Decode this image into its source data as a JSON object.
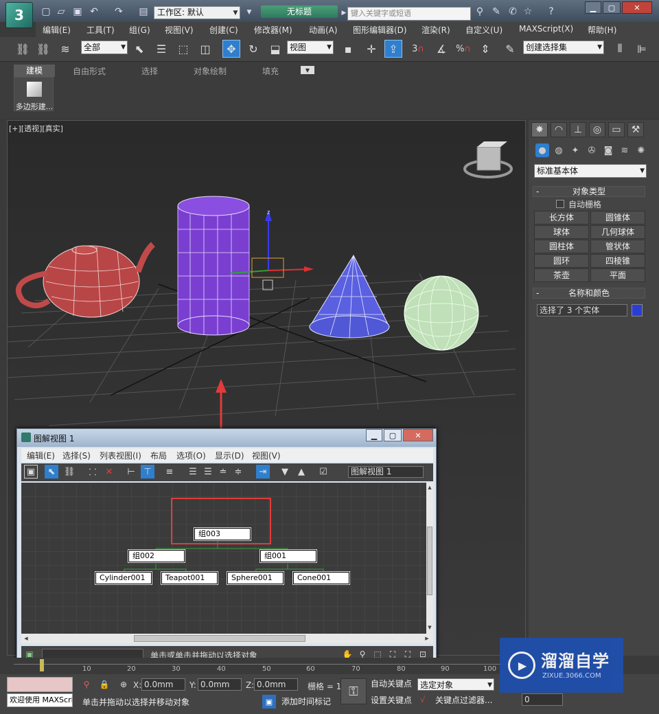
{
  "titlebar": {
    "workspace": "工作区: 默认",
    "doc_title": "无标题",
    "search_placeholder": "键入关键字或短语",
    "help_icon": "?"
  },
  "menubar": [
    "编辑(E)",
    "工具(T)",
    "组(G)",
    "视图(V)",
    "创建(C)",
    "修改器(M)",
    "动画(A)",
    "图形编辑器(D)",
    "渲染(R)",
    "自定义(U)",
    "MAXScript(X)",
    "帮助(H)"
  ],
  "maintoolbar": {
    "selection_filter": "全部",
    "coord_system": "视图",
    "snap_3": "3",
    "snap_angle": "",
    "snap_percent": "%",
    "named_selection": "创建选择集"
  },
  "ribbon": {
    "tabs": [
      "建模",
      "自由形式",
      "选择",
      "对象绘制",
      "填充"
    ],
    "poly_button": "多边形建..."
  },
  "viewport": {
    "label": "[+][透视][真实]"
  },
  "command_panel": {
    "category": "标准基本体",
    "object_type_title": "对象类型",
    "autogrid": "自动栅格",
    "objects": [
      "长方体",
      "圆锥体",
      "球体",
      "几何球体",
      "圆柱体",
      "管状体",
      "圆环",
      "四棱锥",
      "茶壶",
      "平面"
    ],
    "name_color_title": "名称和颜色",
    "name_value": "选择了 3 个实体",
    "swatch_color": "#2a3ed6"
  },
  "schematic": {
    "title": "图解视图 1",
    "menu": [
      "编辑(E)",
      "选择(S)",
      "列表视图(I)",
      "布局",
      "选项(O)",
      "显示(D)",
      "视图(V)"
    ],
    "view_name": "图解视图 1",
    "status_text": "单击或单击并拖动以选择对象",
    "nodes": {
      "group003": "组003",
      "group002": "组002",
      "group001": "组001",
      "cylinder": "Cylinder001",
      "teapot": "Teapot001",
      "sphere": "Sphere001",
      "cone": "Cone001"
    }
  },
  "timeline": {
    "ticks": [
      "10",
      "20",
      "30",
      "40",
      "50",
      "60",
      "70",
      "80",
      "90",
      "100"
    ]
  },
  "statusbar": {
    "welcome": "欢迎使用 MAXScri",
    "prompt": "单击并拖动以选择并移动对象",
    "x_label": "X:",
    "x_value": "0.0mm",
    "y_label": "Y:",
    "y_value": "0.0mm",
    "z_label": "Z:",
    "z_value": "0.0mm",
    "grid_label": "栅格 = 1",
    "auto_key": "自动关键点",
    "set_key": "设置关键点",
    "selected_objects": "选定对象",
    "add_time_tag": "添加时间标记",
    "key_filter": "关键点过滤器...",
    "frame_value": "0"
  },
  "watermark": {
    "title": "溜溜自学",
    "sub": "ZIXUE.3066.COM"
  },
  "colors": {
    "teapot": "#c04a4a",
    "cylinder": "#7a3fd0",
    "cone": "#5a60e0",
    "sphere": "#bfe0b8",
    "highlight": "#e23b3b"
  }
}
